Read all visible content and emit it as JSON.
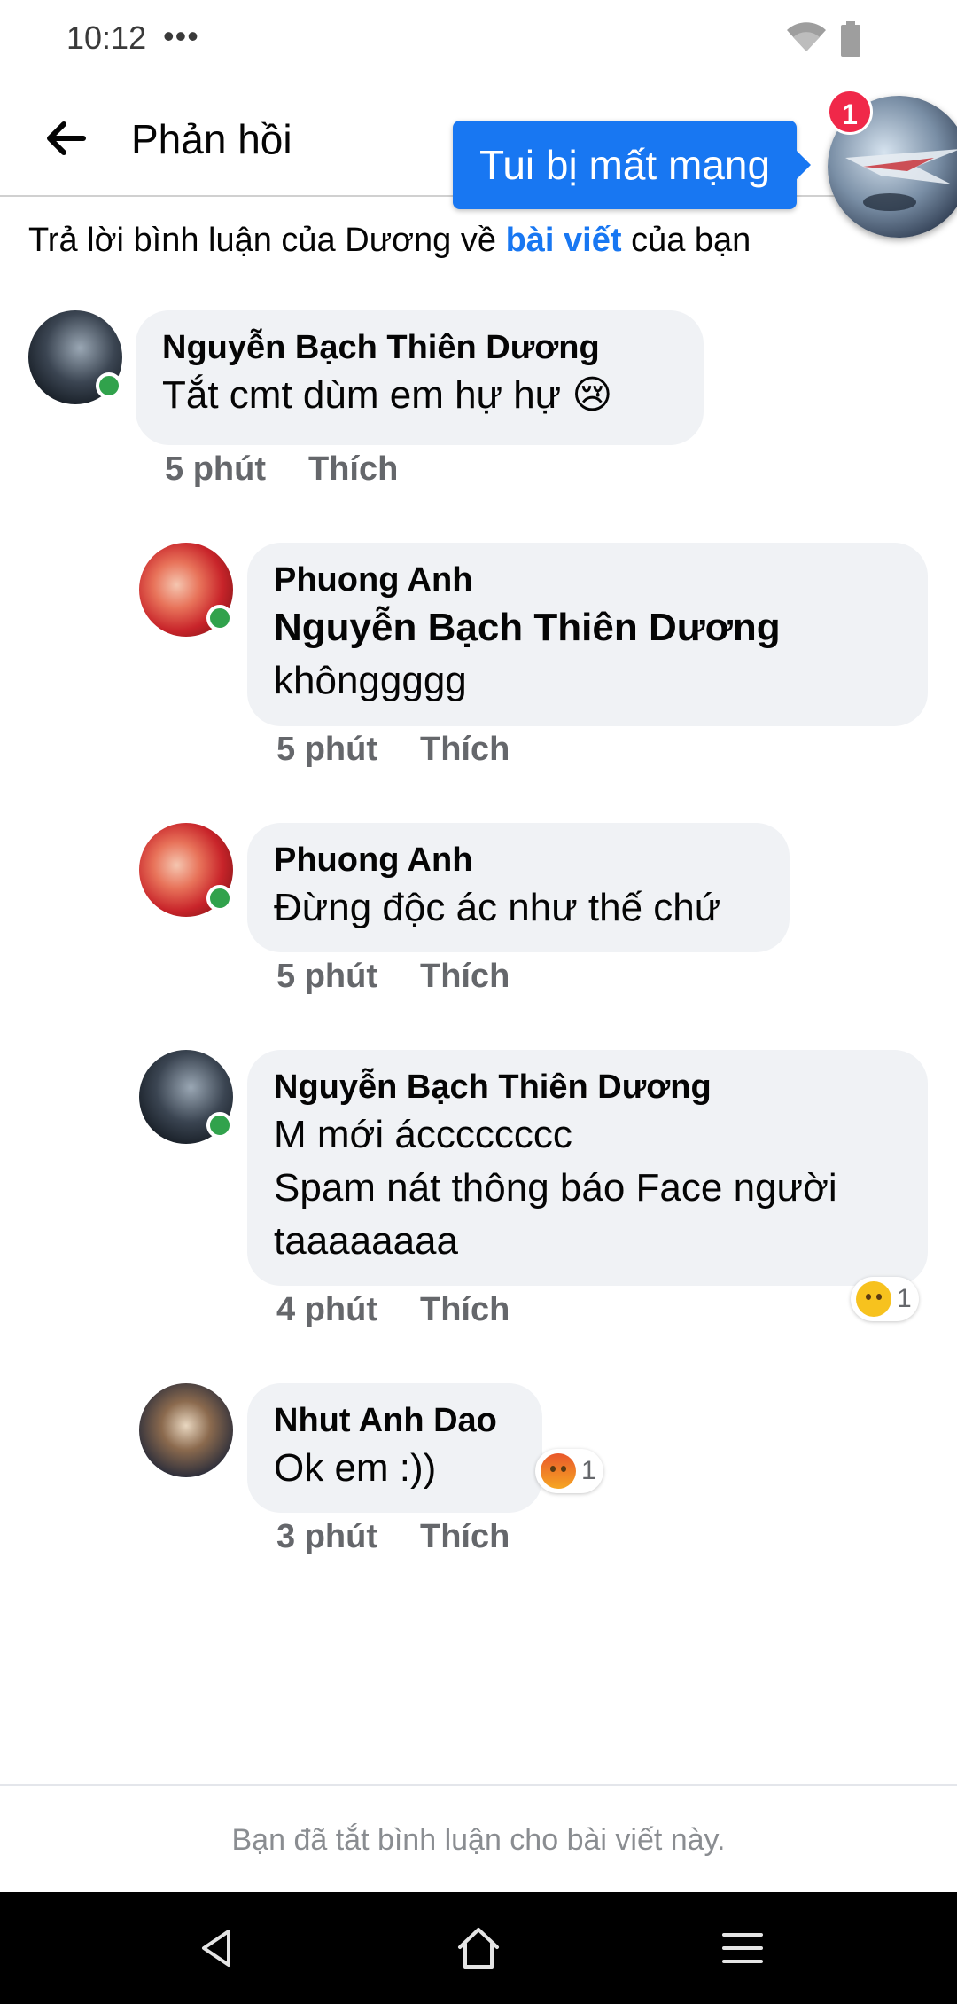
{
  "status_bar": {
    "time": "10:12",
    "dots": "•••",
    "icons": [
      "wifi-icon",
      "battery-icon"
    ]
  },
  "header": {
    "back_icon": "arrow-left-icon",
    "title": "Phản hồi"
  },
  "chat_head": {
    "tooltip": "Tui bị mất mạng",
    "badge": "1"
  },
  "context": {
    "prefix": "Trả lời bình luận của Dương về ",
    "link": "bài viết",
    "suffix": " của bạn"
  },
  "comments": [
    {
      "author": "Nguyễn Bạch Thiên Dương",
      "lines": [
        "Tắt cmt dùm em hự hự 😢"
      ],
      "time": "5 phút",
      "like": "Thích"
    },
    {
      "author": "Phuong Anh",
      "tag": "Nguyễn Bạch Thiên Dương",
      "lines": [
        "khônggggg"
      ],
      "time": "5 phút",
      "like": "Thích"
    },
    {
      "author": "Phuong Anh",
      "lines": [
        "Đừng độc ác như thế chứ"
      ],
      "time": "5 phút",
      "like": "Thích"
    },
    {
      "author": "Nguyễn Bạch Thiên Dương",
      "lines": [
        "M mới ácccccccc",
        "Spam nát thông báo Face người",
        "taaaaaaaa"
      ],
      "time": "4 phút",
      "like": "Thích",
      "reaction": {
        "type": "sad",
        "count": "1"
      }
    },
    {
      "author": "Nhut Anh Dao",
      "lines": [
        "Ok em :))"
      ],
      "time": "3 phút",
      "like": "Thích",
      "reaction": {
        "type": "angry",
        "count": "1"
      }
    }
  ],
  "footer": {
    "notice": "Bạn đã tắt bình luận cho bài viết này."
  },
  "nav_bar": {
    "icons": [
      "back-triangle-icon",
      "home-icon",
      "menu-icon"
    ]
  },
  "colors": {
    "accent": "#1877f2",
    "bubble": "#f0f2f5",
    "online": "#31a24c",
    "badge": "#f02849",
    "meta": "#65676b"
  }
}
